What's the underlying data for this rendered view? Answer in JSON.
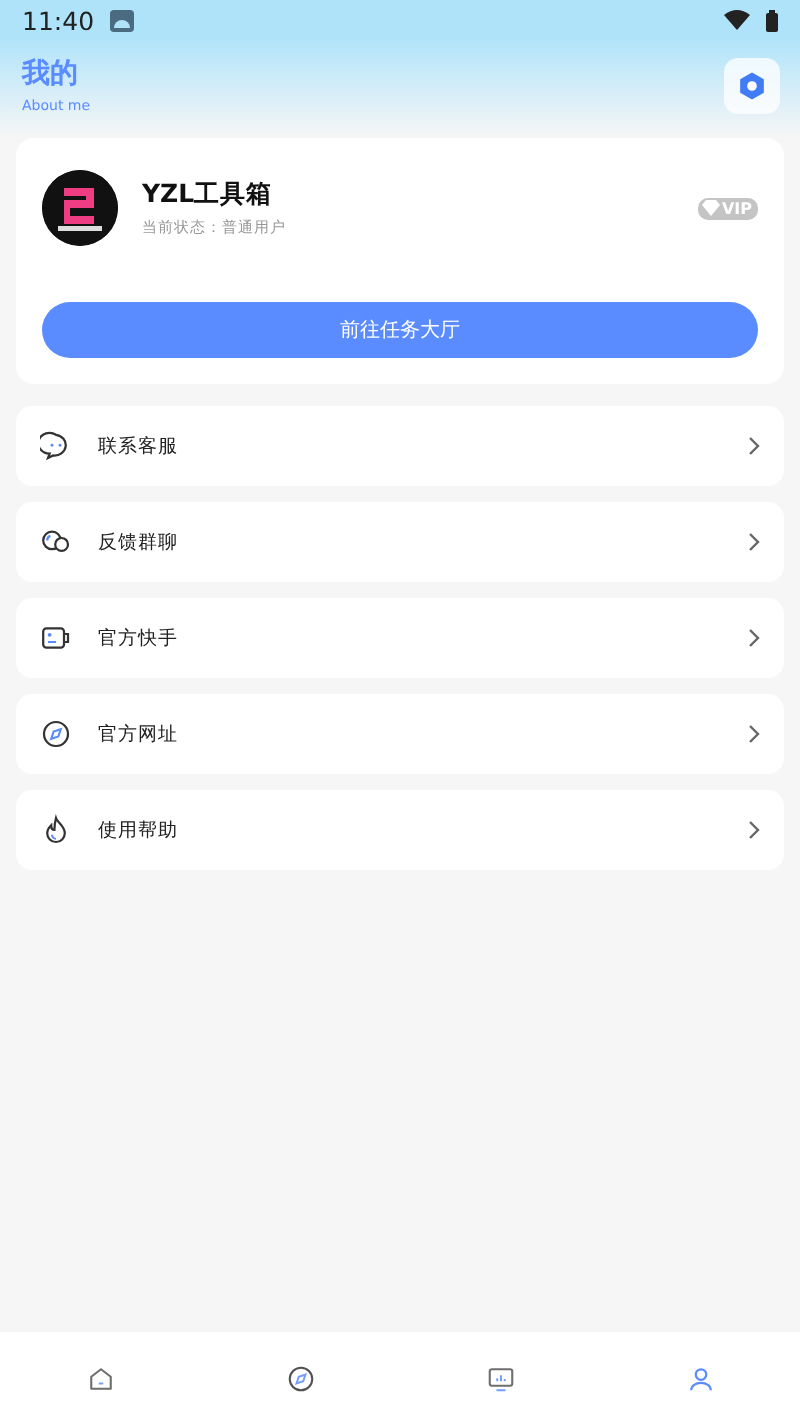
{
  "status_bar": {
    "time": "11:40"
  },
  "header": {
    "title": "我的",
    "subtitle": "About me"
  },
  "profile": {
    "name": "YZL工具箱",
    "status": "当前状态：普通用户",
    "badge": "VIP",
    "button": "前往任务大厅"
  },
  "menu": [
    {
      "label": "联系客服",
      "kind": "chat"
    },
    {
      "label": "反馈群聊",
      "kind": "group"
    },
    {
      "label": "官方快手",
      "kind": "video"
    },
    {
      "label": "官方网址",
      "kind": "compass"
    },
    {
      "label": "使用帮助",
      "kind": "flame"
    }
  ],
  "bottom_nav": [
    {
      "kind": "home",
      "selected": false
    },
    {
      "kind": "compass",
      "selected": false
    },
    {
      "kind": "monitor",
      "selected": false
    },
    {
      "kind": "person",
      "selected": true
    }
  ]
}
